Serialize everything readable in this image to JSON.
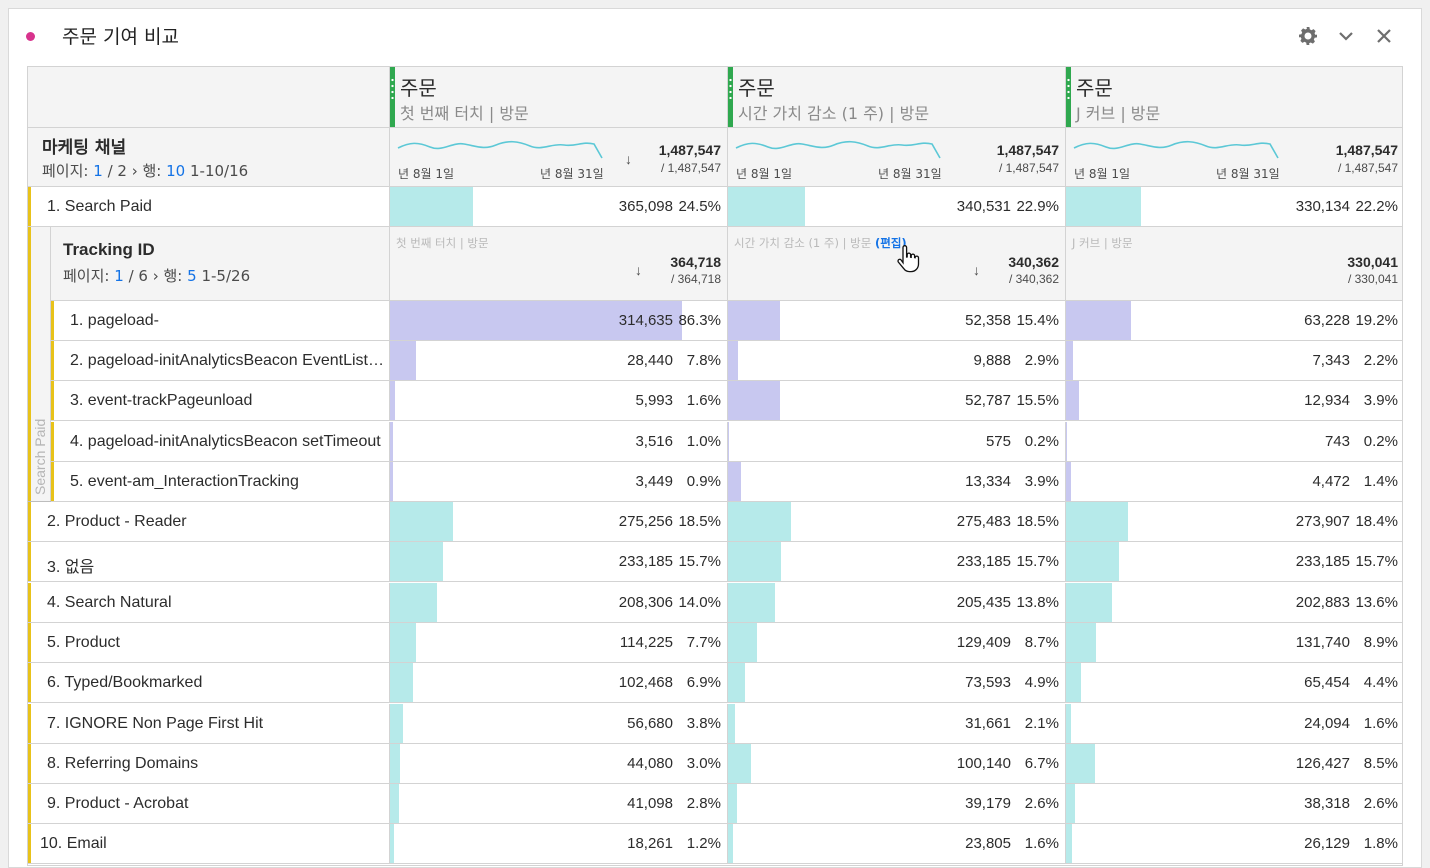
{
  "panel": {
    "title": "주문 기여 비교",
    "dot_color": "#d8338d",
    "icons": [
      "gear-icon",
      "chevron-down-icon",
      "close-icon"
    ]
  },
  "columns": [
    {
      "metric": "주문",
      "model": "첫 번째 터치 | 방문"
    },
    {
      "metric": "주문",
      "model": "시간 가치 감소 (1 주) | 방문"
    },
    {
      "metric": "주문",
      "model": "J 커브 | 방문"
    }
  ],
  "dimension": {
    "title": "마케팅 채널",
    "page_label": "페이지:",
    "page": "1",
    "page_sep": " / 2",
    "rows_label": "행:",
    "rows": "10",
    "range": "1-10/16"
  },
  "summary": [
    {
      "date_start": "년 8월 1일",
      "date_end": "년 8월 31일",
      "total": "1,487,547",
      "of_total": "/ 1,487,547"
    },
    {
      "date_start": "년 8월 1일",
      "date_end": "년 8월 31일",
      "total": "1,487,547",
      "of_total": "/ 1,487,547"
    },
    {
      "date_start": "년 8월 1일",
      "date_end": "년 8월 31일",
      "total": "1,487,547",
      "of_total": "/ 1,487,547"
    }
  ],
  "breakdown": {
    "side_label": "Search Paid",
    "title": "Tracking ID",
    "page_label": "페이지:",
    "page": "1",
    "page_sep": " / 6",
    "rows_label": "행:",
    "rows": "5",
    "range": "1-5/26",
    "edit_label": "(편집)",
    "headers": [
      {
        "metric": "첫 번째 터치 | 방문",
        "total": "364,718",
        "of_total": "/ 364,718"
      },
      {
        "metric": "시간 가치 감소 (1 주) | 방문",
        "total": "340,362",
        "of_total": "/ 340,362"
      },
      {
        "metric": "J 커브 | 방문",
        "total": "330,041",
        "of_total": "/ 330,041"
      }
    ],
    "items": [
      {
        "label": "1. pageload-",
        "cells": [
          {
            "value": "314,635",
            "pct": "86.3%",
            "fill": 0.863
          },
          {
            "value": "52,358",
            "pct": "15.4%",
            "fill": 0.154
          },
          {
            "value": "63,228",
            "pct": "19.2%",
            "fill": 0.192
          }
        ]
      },
      {
        "label": "2. pageload-initAnalyticsBeacon EventListen…",
        "cells": [
          {
            "value": "28,440",
            "pct": "7.8%",
            "fill": 0.078
          },
          {
            "value": "9,888",
            "pct": "2.9%",
            "fill": 0.029
          },
          {
            "value": "7,343",
            "pct": "2.2%",
            "fill": 0.022
          }
        ]
      },
      {
        "label": "3. event-trackPageunload",
        "cells": [
          {
            "value": "5,993",
            "pct": "1.6%",
            "fill": 0.016
          },
          {
            "value": "52,787",
            "pct": "15.5%",
            "fill": 0.155
          },
          {
            "value": "12,934",
            "pct": "3.9%",
            "fill": 0.039
          }
        ]
      },
      {
        "label": "4. pageload-initAnalyticsBeacon setTimeout",
        "cells": [
          {
            "value": "3,516",
            "pct": "1.0%",
            "fill": 0.01
          },
          {
            "value": "575",
            "pct": "0.2%",
            "fill": 0.002
          },
          {
            "value": "743",
            "pct": "0.2%",
            "fill": 0.002
          }
        ]
      },
      {
        "label": "5. event-am_InteractionTracking",
        "cells": [
          {
            "value": "3,449",
            "pct": "0.9%",
            "fill": 0.009
          },
          {
            "value": "13,334",
            "pct": "3.9%",
            "fill": 0.039
          },
          {
            "value": "4,472",
            "pct": "1.4%",
            "fill": 0.014
          }
        ]
      }
    ]
  },
  "rows": [
    {
      "label": "1. Search Paid",
      "cells": [
        {
          "value": "365,098",
          "pct": "24.5%",
          "fill": 0.245
        },
        {
          "value": "340,531",
          "pct": "22.9%",
          "fill": 0.229
        },
        {
          "value": "330,134",
          "pct": "22.2%",
          "fill": 0.222
        }
      ]
    },
    {
      "label": "2. Product - Reader",
      "cells": [
        {
          "value": "275,256",
          "pct": "18.5%",
          "fill": 0.185
        },
        {
          "value": "275,483",
          "pct": "18.5%",
          "fill": 0.185
        },
        {
          "value": "273,907",
          "pct": "18.4%",
          "fill": 0.184
        }
      ]
    },
    {
      "label": "3. 없음",
      "cells": [
        {
          "value": "233,185",
          "pct": "15.7%",
          "fill": 0.157
        },
        {
          "value": "233,185",
          "pct": "15.7%",
          "fill": 0.157
        },
        {
          "value": "233,185",
          "pct": "15.7%",
          "fill": 0.157
        }
      ]
    },
    {
      "label": "4. Search Natural",
      "cells": [
        {
          "value": "208,306",
          "pct": "14.0%",
          "fill": 0.14
        },
        {
          "value": "205,435",
          "pct": "13.8%",
          "fill": 0.138
        },
        {
          "value": "202,883",
          "pct": "13.6%",
          "fill": 0.136
        }
      ]
    },
    {
      "label": "5. Product",
      "cells": [
        {
          "value": "114,225",
          "pct": "7.7%",
          "fill": 0.077
        },
        {
          "value": "129,409",
          "pct": "8.7%",
          "fill": 0.087
        },
        {
          "value": "131,740",
          "pct": "8.9%",
          "fill": 0.089
        }
      ]
    },
    {
      "label": "6. Typed/Bookmarked",
      "cells": [
        {
          "value": "102,468",
          "pct": "6.9%",
          "fill": 0.069
        },
        {
          "value": "73,593",
          "pct": "4.9%",
          "fill": 0.049
        },
        {
          "value": "65,454",
          "pct": "4.4%",
          "fill": 0.044
        }
      ]
    },
    {
      "label": "7. IGNORE Non Page First Hit",
      "cells": [
        {
          "value": "56,680",
          "pct": "3.8%",
          "fill": 0.038
        },
        {
          "value": "31,661",
          "pct": "2.1%",
          "fill": 0.021
        },
        {
          "value": "24,094",
          "pct": "1.6%",
          "fill": 0.016
        }
      ]
    },
    {
      "label": "8. Referring Domains",
      "cells": [
        {
          "value": "44,080",
          "pct": "3.0%",
          "fill": 0.03
        },
        {
          "value": "100,140",
          "pct": "6.7%",
          "fill": 0.067
        },
        {
          "value": "126,427",
          "pct": "8.5%",
          "fill": 0.085
        }
      ]
    },
    {
      "label": "9. Product - Acrobat",
      "cells": [
        {
          "value": "41,098",
          "pct": "2.8%",
          "fill": 0.028
        },
        {
          "value": "39,179",
          "pct": "2.6%",
          "fill": 0.026
        },
        {
          "value": "38,318",
          "pct": "2.6%",
          "fill": 0.026
        }
      ]
    },
    {
      "label": "10. Email",
      "cells": [
        {
          "value": "18,261",
          "pct": "1.2%",
          "fill": 0.012
        },
        {
          "value": "23,805",
          "pct": "1.6%",
          "fill": 0.016
        },
        {
          "value": "26,129",
          "pct": "1.8%",
          "fill": 0.018
        }
      ]
    }
  ],
  "colors": {
    "column_accent": "#2fa84f",
    "row_accent": "#e8c21a",
    "bar_fill": "#b6eaea",
    "breakdown_bar_fill": "#c8c8f0",
    "sparkline": "#5cc8d6",
    "link": "#1473e6"
  }
}
